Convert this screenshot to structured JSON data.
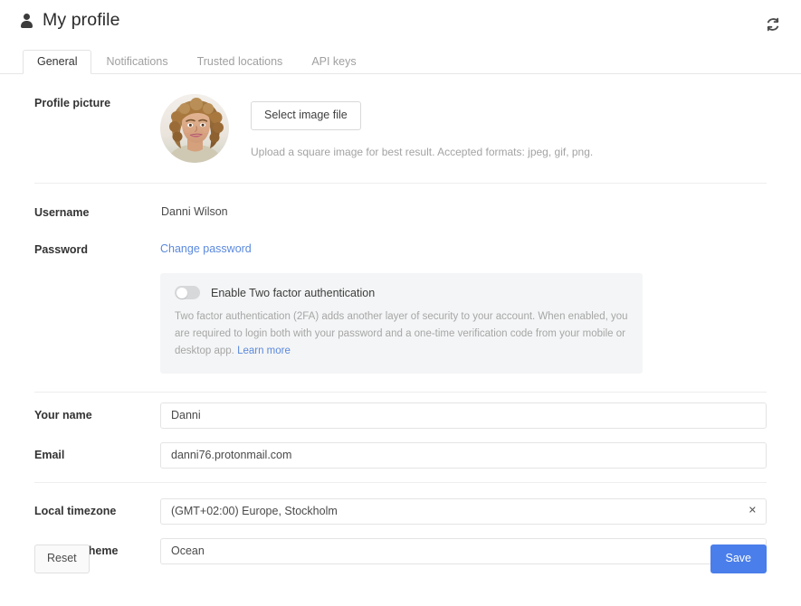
{
  "header": {
    "title": "My profile",
    "icon": "person-icon",
    "refresh_icon": "refresh-icon"
  },
  "tabs": [
    {
      "label": "General",
      "active": true
    },
    {
      "label": "Notifications",
      "active": false
    },
    {
      "label": "Trusted locations",
      "active": false
    },
    {
      "label": "API keys",
      "active": false
    }
  ],
  "profile_picture": {
    "label": "Profile picture",
    "button_label": "Select image file",
    "hint": "Upload a square image for best result. Accepted formats: jpeg, gif, png."
  },
  "username": {
    "label": "Username",
    "value": "Danni Wilson"
  },
  "password": {
    "label": "Password",
    "link_label": "Change password"
  },
  "two_factor": {
    "toggle_label": "Enable Two factor authentication",
    "enabled": false,
    "description": "Two factor authentication (2FA) adds another layer of security to your account. When enabled, you are required to login both with your password and a one-time verification code from your mobile or desktop app.",
    "learn_more_label": "Learn more"
  },
  "your_name": {
    "label": "Your name",
    "value": "Danni"
  },
  "email": {
    "label": "Email",
    "value": "danni76.protonmail.com"
  },
  "timezone": {
    "label": "Local timezone",
    "value": "(GMT+02:00) Europe, Stockholm",
    "clear_icon": "close-icon"
  },
  "theme": {
    "label": "Interface theme",
    "value": "Ocean",
    "chevron_icon": "chevron-down-icon"
  },
  "footer": {
    "reset_label": "Reset",
    "save_label": "Save"
  },
  "colors": {
    "accent": "#4a7eea",
    "link": "#5b89dd",
    "panel_bg": "#f4f5f6",
    "divider": "#eeeeee"
  }
}
